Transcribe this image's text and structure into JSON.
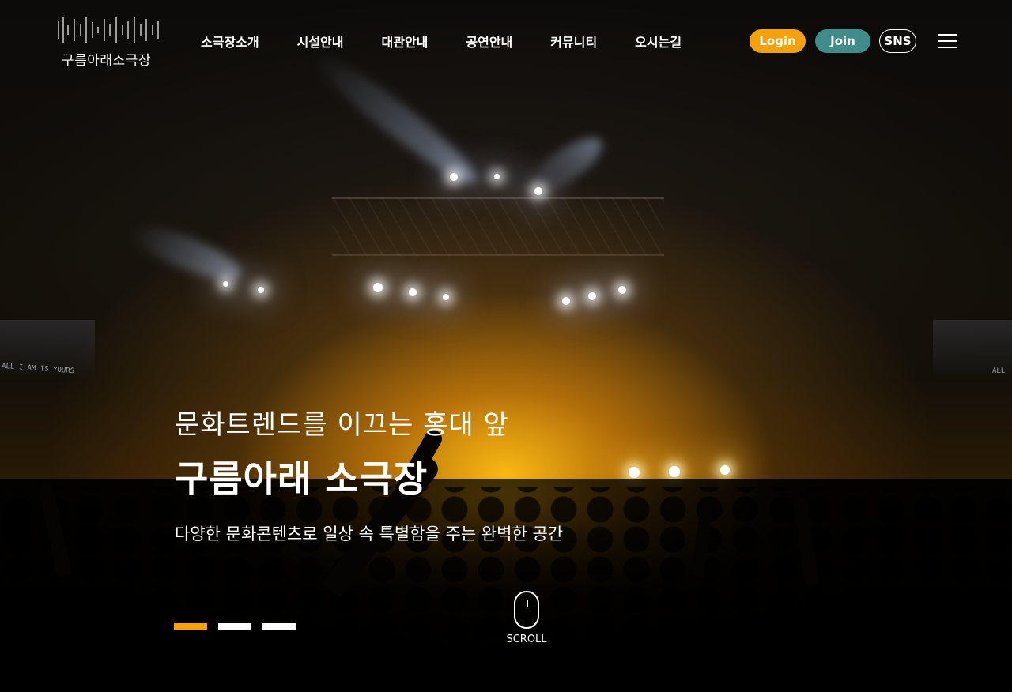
{
  "header": {
    "logo_text": "구름아래소극장",
    "nav": [
      {
        "label": "소극장소개"
      },
      {
        "label": "시설안내"
      },
      {
        "label": "대관안내"
      },
      {
        "label": "공연안내"
      },
      {
        "label": "커뮤니티"
      },
      {
        "label": "오시는길"
      }
    ],
    "login_label": "Login",
    "join_label": "Join",
    "sns_label": "SNS",
    "menu_icon": "hamburger-menu-icon"
  },
  "hero": {
    "subtitle": "문화트렌드를 이끄는 홍대 앞",
    "title": "구름아래 소극장",
    "description": "다양한 문화콘텐츠로 일상 속 특별함을 주는 완벽한 공간",
    "screen_text_left": "ALL I AM IS YOURS",
    "screen_text_right": "ALL",
    "slides": [
      {
        "active": true
      },
      {
        "active": false
      },
      {
        "active": false
      }
    ],
    "scroll_label": "SCROLL"
  },
  "colors": {
    "accent": "#f4a10b",
    "join": "#3f8c8a",
    "text": "#ffffff"
  }
}
